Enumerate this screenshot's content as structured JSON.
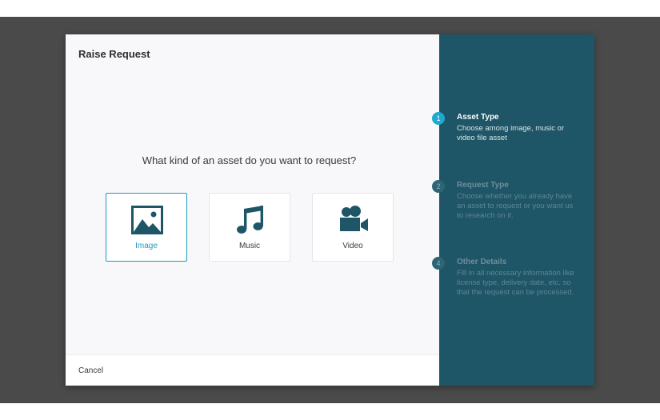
{
  "modal": {
    "title": "Raise Request",
    "question": "What kind of an asset do you want to request?",
    "cancel_label": "Cancel"
  },
  "options": [
    {
      "label": "Image",
      "icon": "image-icon",
      "selected": true
    },
    {
      "label": "Music",
      "icon": "music-note-icon",
      "selected": false
    },
    {
      "label": "Video",
      "icon": "video-camera-icon",
      "selected": false
    }
  ],
  "steps": [
    {
      "number": "1",
      "title": "Asset Type",
      "description": "Choose among image, music or video file asset",
      "active": true
    },
    {
      "number": "2",
      "title": "Request Type",
      "description": "Choose whether you already have an asset to request or you want us to research on it.",
      "active": false
    },
    {
      "number": "4",
      "title": "Other Details",
      "description": "Fill in all necessary information like license type, delivery date, etc. so that the request can be processed.",
      "active": false
    }
  ],
  "colors": {
    "accent": "#1a9bbf",
    "sidebar_bg": "#1e5567",
    "icon_fill": "#1e5567",
    "overlay": "#4a4a4a"
  }
}
